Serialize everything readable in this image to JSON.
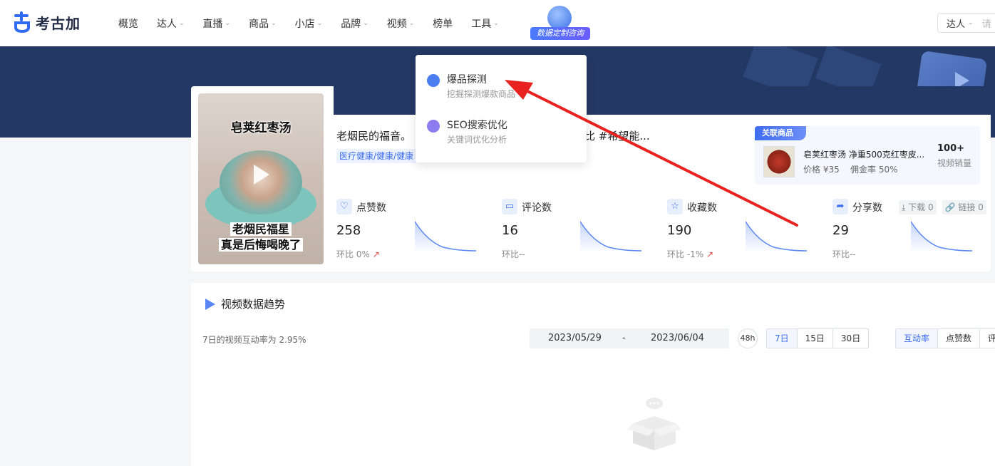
{
  "header": {
    "logo_text": "考古加",
    "nav": [
      {
        "label": "概览",
        "has_menu": false
      },
      {
        "label": "达人",
        "has_menu": true
      },
      {
        "label": "直播",
        "has_menu": true
      },
      {
        "label": "商品",
        "has_menu": true
      },
      {
        "label": "小店",
        "has_menu": true
      },
      {
        "label": "品牌",
        "has_menu": true
      },
      {
        "label": "视频",
        "has_menu": true
      },
      {
        "label": "榜单",
        "has_menu": false
      },
      {
        "label": "工具",
        "has_menu": true
      }
    ],
    "promo_label": "数据定制咨询",
    "search_type": "达人",
    "search_placeholder": "请"
  },
  "dropdown": {
    "items": [
      {
        "title": "爆品探测",
        "subtitle": "挖掘探测爆款商品",
        "icon": "gauge-icon"
      },
      {
        "title": "SEO搜索优化",
        "subtitle": "关键词优化分析",
        "icon": "cloud-seo-icon"
      }
    ]
  },
  "video": {
    "thumbnail_caption_top": "皂荚红枣汤",
    "thumbnail_caption_bottom_1": "老烟民福星",
    "thumbnail_caption_bottom_2": "真是后悔喝晚了",
    "title": "老烟民的福音。",
    "title_tail": "比 #希望能...",
    "tag": "医疗健康/健康/健康",
    "related": {
      "badge": "关联商品",
      "name": "皂荚红枣汤 净重500克红枣皮...",
      "price_label": "价格",
      "price": "¥35",
      "commission_label": "佣金率",
      "commission": "50%",
      "sales": "100+",
      "sales_label": "视频销量"
    },
    "metrics": [
      {
        "label": "点赞数",
        "value": "258",
        "ratio": "环比 0%",
        "trend_up": true,
        "icon": "heart-icon"
      },
      {
        "label": "评论数",
        "value": "16",
        "ratio": "环比--",
        "trend_up": false,
        "icon": "comment-icon"
      },
      {
        "label": "收藏数",
        "value": "190",
        "ratio": "环比 -1%",
        "trend_up": true,
        "icon": "star-icon"
      },
      {
        "label": "分享数",
        "value": "29",
        "ratio": "环比--",
        "trend_up": false,
        "icon": "share-icon"
      }
    ],
    "share_extra": {
      "download": "下载 0",
      "link": "链接 0"
    }
  },
  "trend": {
    "title": "视频数据趋势",
    "desc": "7日的视频互动率为 2.95%",
    "date_start": "2023/05/29",
    "date_sep": "-",
    "date_end": "2023/06/04",
    "h48": "48h",
    "ranges": [
      "7日",
      "15日",
      "30日"
    ],
    "active_range": "7日",
    "metrics_tabs": [
      "互动率",
      "点赞数",
      "评"
    ],
    "active_metric": "互动率"
  },
  "colors": {
    "accent": "#3c6ef0",
    "banner": "#243865",
    "arrow": "#e8231f"
  }
}
